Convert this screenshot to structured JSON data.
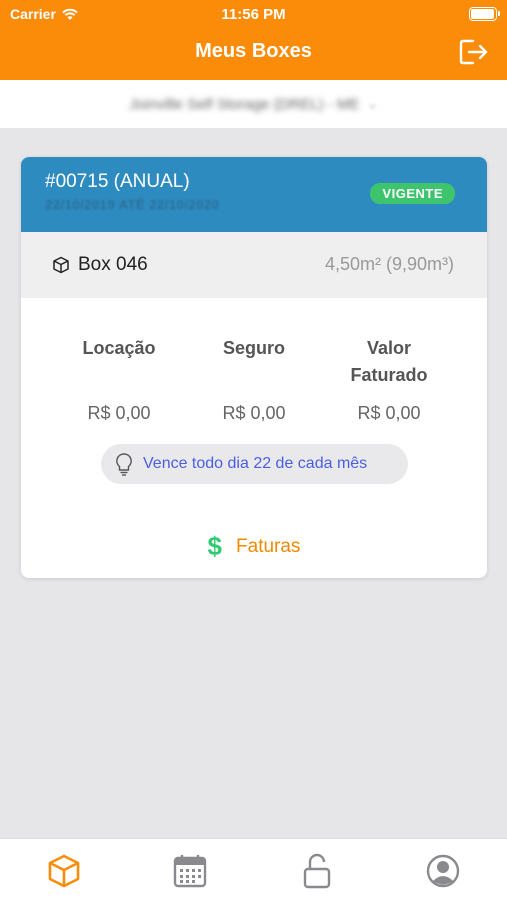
{
  "status": {
    "carrier": "Carrier",
    "time": "11:56 PM",
    "battery_level": 1.0
  },
  "nav": {
    "title": "Meus Boxes"
  },
  "selector": {
    "company": "Joinville Self Storage (DREL) - ME",
    "chevron": "⌄"
  },
  "contract": {
    "number": "#00715 (ANUAL)",
    "period": "22/10/2019 ATÉ 22/10/2020",
    "status": "VIGENTE",
    "box_name": "Box 046",
    "box_size": "4,50m² (9,90m³)",
    "columns": [
      {
        "label": "Locação",
        "value": "R$ 0,00"
      },
      {
        "label": "Seguro",
        "value": "R$ 0,00"
      },
      {
        "label": "Valor Faturado",
        "value": "R$ 0,00"
      }
    ],
    "due_note": "Vence todo dia 22 de cada mês",
    "invoices_label": "Faturas",
    "invoices_symbol": "$"
  },
  "colors": {
    "brand": "#fa8c0a",
    "header": "#2e8bc0",
    "badge": "#3ec46d",
    "link": "#f08a00"
  },
  "tabs": [
    {
      "icon": "box-icon",
      "active": true
    },
    {
      "icon": "calendar-icon",
      "active": false
    },
    {
      "icon": "unlock-icon",
      "active": false
    },
    {
      "icon": "profile-icon",
      "active": false
    }
  ]
}
